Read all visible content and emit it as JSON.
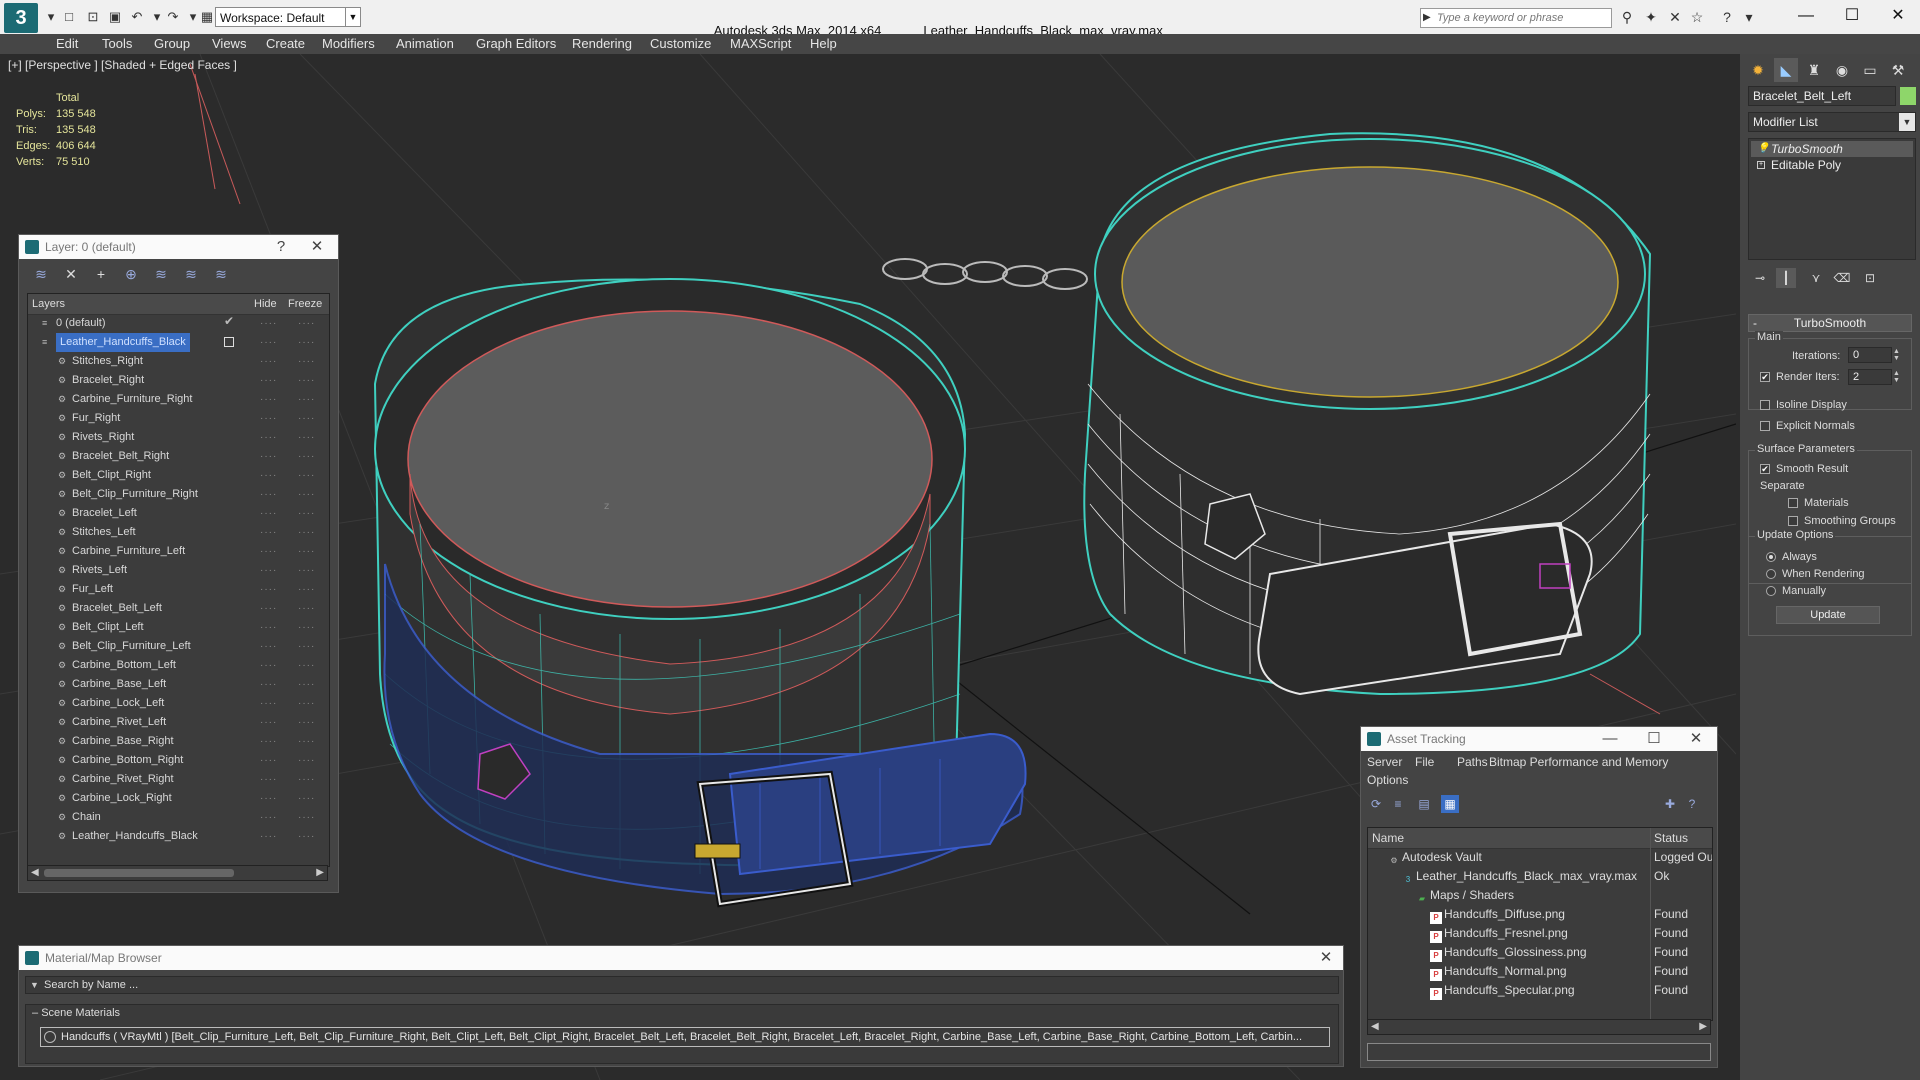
{
  "titlebar": {
    "workspace": "Workspace: Default",
    "app_title": "Autodesk 3ds Max  2014 x64",
    "file_name": "Leather_Handcuffs_Black_max_vray.max",
    "search_placeholder": "Type a keyword or phrase"
  },
  "menu": [
    "Edit",
    "Tools",
    "Group",
    "Views",
    "Create",
    "Modifiers",
    "Animation",
    "Graph Editors",
    "Rendering",
    "Customize",
    "MAXScript",
    "Help"
  ],
  "viewport": {
    "label": "[+] [Perspective ] [Shaded + Edged Faces ]",
    "stats": {
      "total": "Total",
      "polys_label": "Polys:",
      "polys": "135 548",
      "tris_label": "Tris:",
      "tris": "135 548",
      "edges_label": "Edges:",
      "edges": "406 644",
      "verts_label": "Verts:",
      "verts": "75 510"
    }
  },
  "layer_window": {
    "title": "Layer: 0 (default)",
    "help": "?",
    "col_layers": "Layers",
    "col_hide": "Hide",
    "col_freeze": "Freeze",
    "rows": [
      "0 (default)",
      "Leather_Handcuffs_Black",
      "Stitches_Right",
      "Bracelet_Right",
      "Carbine_Furniture_Right",
      "Fur_Right",
      "Rivets_Right",
      "Bracelet_Belt_Right",
      "Belt_Clipt_Right",
      "Belt_Clip_Furniture_Right",
      "Bracelet_Left",
      "Stitches_Left",
      "Carbine_Furniture_Left",
      "Rivets_Left",
      "Fur_Left",
      "Bracelet_Belt_Left",
      "Belt_Clipt_Left",
      "Belt_Clip_Furniture_Left",
      "Carbine_Bottom_Left",
      "Carbine_Base_Left",
      "Carbine_Lock_Left",
      "Carbine_Rivet_Left",
      "Carbine_Base_Right",
      "Carbine_Bottom_Right",
      "Carbine_Rivet_Right",
      "Carbine_Lock_Right",
      "Chain",
      "Leather_Handcuffs_Black"
    ]
  },
  "asset_window": {
    "title": "Asset Tracking",
    "menu": [
      "Server",
      "File",
      "Paths",
      "Bitmap Performance and Memory",
      "Options"
    ],
    "col_name": "Name",
    "col_status": "Status",
    "rows": [
      {
        "name": "Autodesk Vault",
        "status": "Logged Out",
        "indent": 1,
        "icon": "vault-icon"
      },
      {
        "name": "Leather_Handcuffs_Black_max_vray.max",
        "status": "Ok",
        "indent": 2,
        "icon": "max-file-icon"
      },
      {
        "name": "Maps / Shaders",
        "status": "",
        "indent": 3,
        "icon": "maps-folder-icon"
      },
      {
        "name": "Handcuffs_Diffuse.png",
        "status": "Found",
        "indent": 4,
        "icon": "png-icon"
      },
      {
        "name": "Handcuffs_Fresnel.png",
        "status": "Found",
        "indent": 4,
        "icon": "png-icon"
      },
      {
        "name": "Handcuffs_Glossiness.png",
        "status": "Found",
        "indent": 4,
        "icon": "png-icon"
      },
      {
        "name": "Handcuffs_Normal.png",
        "status": "Found",
        "indent": 4,
        "icon": "png-icon"
      },
      {
        "name": "Handcuffs_Specular.png",
        "status": "Found",
        "indent": 4,
        "icon": "png-icon"
      }
    ]
  },
  "material_browser": {
    "title": "Material/Map Browser",
    "search_placeholder": "Search by Name ...",
    "group": "Scene Materials",
    "item": "Handcuffs ( VRayMtl ) [Belt_Clip_Furniture_Left, Belt_Clip_Furniture_Right, Belt_Clipt_Left, Belt_Clipt_Right, Bracelet_Belt_Left, Bracelet_Belt_Right, Bracelet_Left, Bracelet_Right, Carbine_Base_Left, Carbine_Base_Right, Carbine_Bottom_Left, Carbin..."
  },
  "command_panel": {
    "object_name": "Bracelet_Belt_Left",
    "object_color": "#8ed66a",
    "modifier_list": "Modifier List",
    "stack": [
      "TurboSmooth",
      "Editable Poly"
    ],
    "rollout_title": "TurboSmooth",
    "main_group": "Main",
    "iterations_label": "Iterations:",
    "iterations": "0",
    "render_iters_label": "Render Iters:",
    "render_iters": "2",
    "isoline": "Isoline Display",
    "explicit_normals": "Explicit Normals",
    "surface_group": "Surface Parameters",
    "smooth_result": "Smooth Result",
    "separate": "Separate",
    "materials": "Materials",
    "smoothing_groups": "Smoothing Groups",
    "update_group": "Update Options",
    "always": "Always",
    "when_rendering": "When Rendering",
    "manually": "Manually",
    "update_button": "Update"
  },
  "colors": {
    "accent": "#3a6ec4",
    "wire_cyan": "#3fd0c0",
    "wire_blue": "#3a5ccc",
    "wire_white": "#e8e8e8",
    "wire_red": "#d05a5a",
    "stats_text": "#e4e49a"
  }
}
